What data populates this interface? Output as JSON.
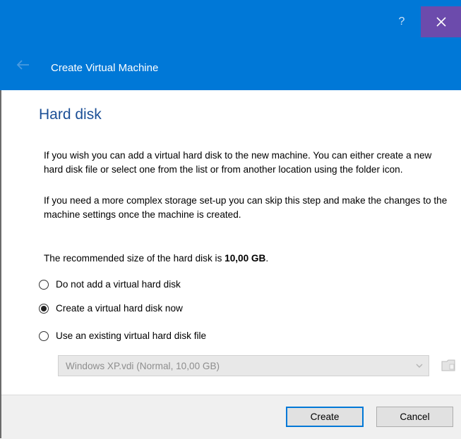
{
  "titlebar": {
    "help_label": "?",
    "close_icon": "close-icon",
    "accent_color": "#0078d7",
    "close_color": "#6c4bac"
  },
  "header": {
    "back_icon": "back-arrow-icon",
    "title": "Create Virtual Machine"
  },
  "page": {
    "section_title": "Hard disk",
    "para1": "If you wish you can add a virtual hard disk to the new machine. You can either create a new hard disk file or select one from the list or from another location using the folder icon.",
    "para2": "If you need a more complex storage set-up you can skip this step and make the changes to the machine settings once the machine is created.",
    "para3_prefix": "The recommended size of the hard disk is ",
    "para3_value": "10,00 GB",
    "para3_suffix": "."
  },
  "options": [
    {
      "label": "Do not add a virtual hard disk",
      "selected": false
    },
    {
      "label": "Create a virtual hard disk now",
      "selected": true
    },
    {
      "label": "Use an existing virtual hard disk file",
      "selected": false
    }
  ],
  "disk_select": {
    "value": "Windows XP.vdi (Normal, 10,00 GB)",
    "enabled": false,
    "folder_icon": "folder-icon"
  },
  "buttons": {
    "create": "Create",
    "cancel": "Cancel"
  }
}
